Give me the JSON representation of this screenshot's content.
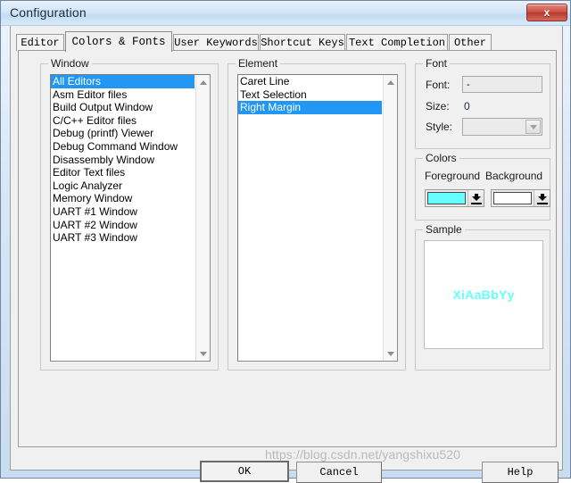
{
  "window": {
    "title": "Configuration",
    "close_icon": "close-icon",
    "close_label": "x"
  },
  "tabs": [
    {
      "label": "Editor",
      "active": false
    },
    {
      "label": "Colors & Fonts",
      "active": true
    },
    {
      "label": "User Keywords",
      "active": false
    },
    {
      "label": "Shortcut Keys",
      "active": false
    },
    {
      "label": "Text Completion",
      "active": false
    },
    {
      "label": "Other",
      "active": false
    }
  ],
  "window_group": {
    "title": "Window",
    "selected_index": 0,
    "items": [
      "All Editors",
      "Asm Editor files",
      "Build Output Window",
      "C/C++ Editor files",
      "Debug (printf) Viewer",
      "Debug Command Window",
      "Disassembly Window",
      "Editor Text files",
      "Logic Analyzer",
      "Memory Window",
      "UART #1 Window",
      "UART #2 Window",
      "UART #3 Window"
    ],
    "scroll_up_icon": "triangle-up-icon",
    "scroll_down_icon": "triangle-down-icon"
  },
  "element_group": {
    "title": "Element",
    "selected_index": 2,
    "items": [
      "Caret Line",
      "Text Selection",
      "Right Margin"
    ],
    "scroll_up_icon": "triangle-up-icon",
    "scroll_down_icon": "triangle-down-icon"
  },
  "font_group": {
    "title": "Font",
    "font_label": "Font:",
    "font_value": "-",
    "size_label": "Size:",
    "size_value": "0",
    "style_label": "Style:",
    "style_value": "",
    "style_dropdown_icon": "chevron-down-icon"
  },
  "colors_group": {
    "title": "Colors",
    "foreground_label": "Foreground",
    "background_label": "Background",
    "foreground_color": "#66FFFF",
    "background_color": "#FFFFFF",
    "dropper_icon": "color-dropdown-icon"
  },
  "sample_group": {
    "title": "Sample",
    "text": "XiAaBbYy",
    "text_color": "#66FFFF",
    "bg_color": "#FFFFFF"
  },
  "buttons": {
    "ok": "OK",
    "cancel": "Cancel",
    "help": "Help"
  },
  "watermark": "https://blog.csdn.net/yangshixu520"
}
